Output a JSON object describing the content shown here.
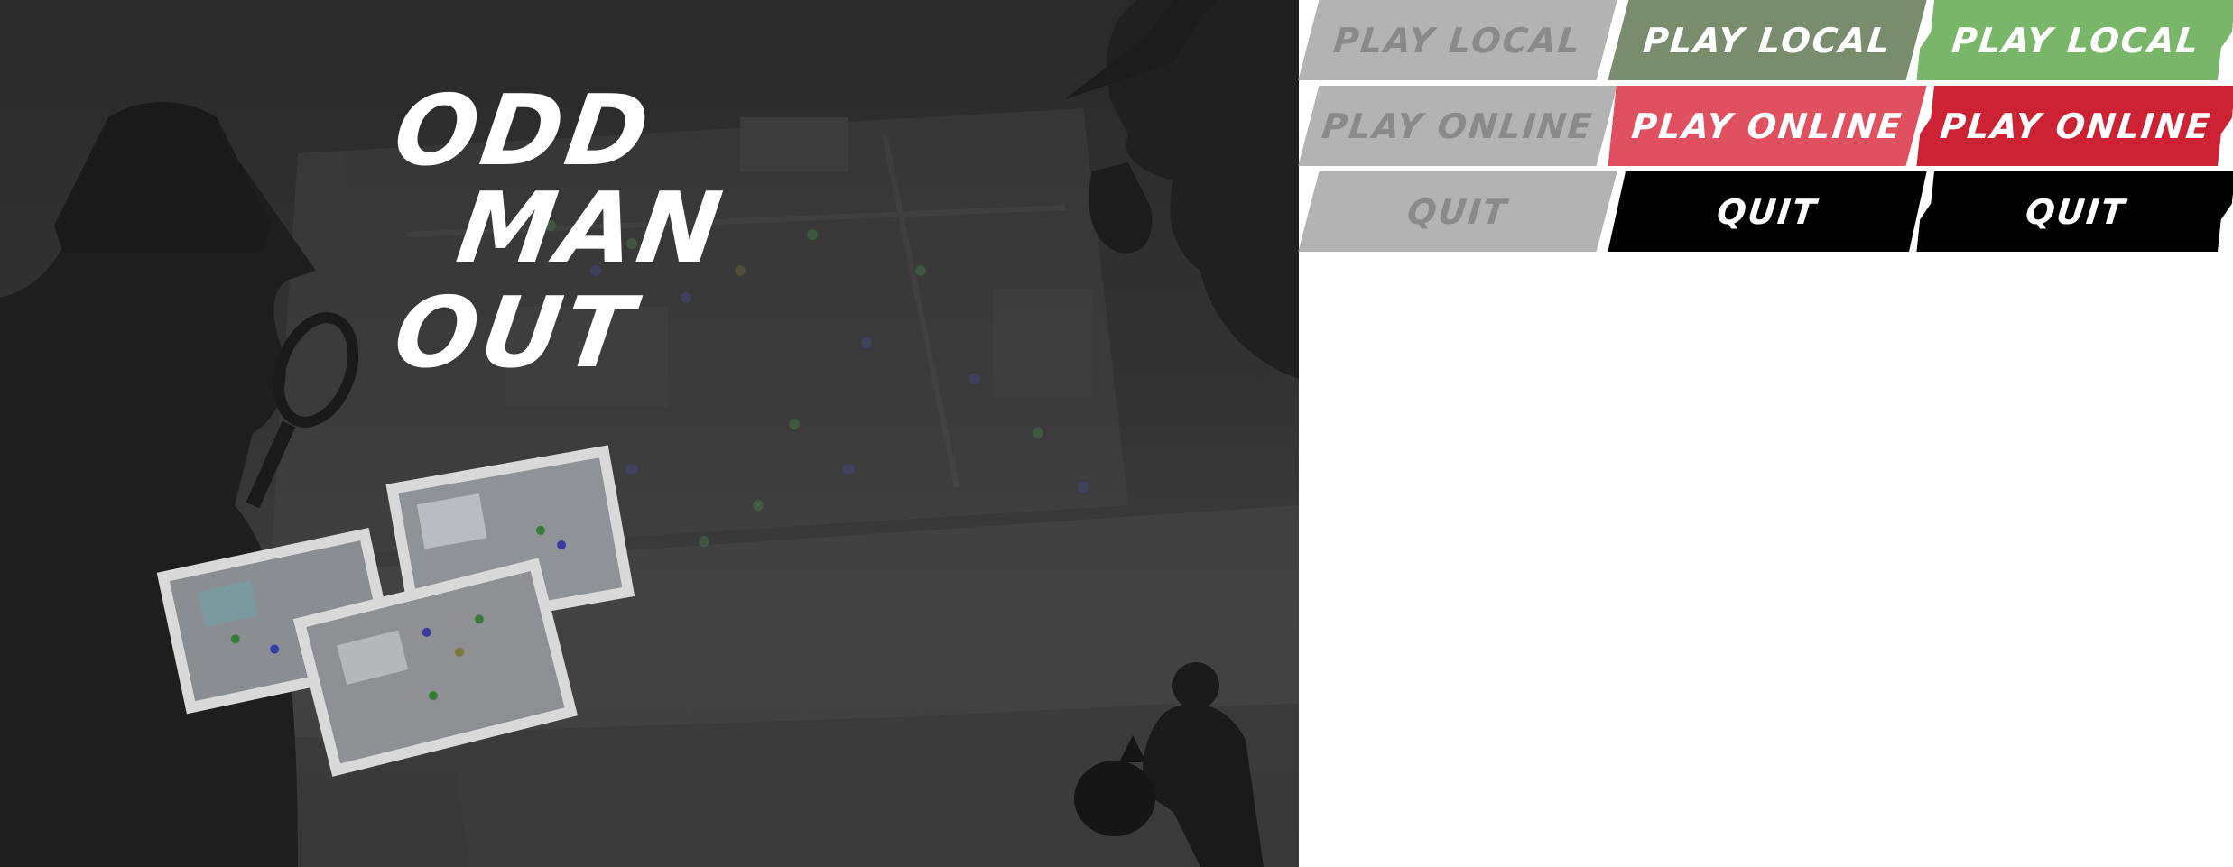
{
  "game_title": {
    "line1": "ODD",
    "line2": "MAN",
    "line3": "OUT"
  },
  "button_sheet": {
    "column_disabled": {
      "play_local": "PLAY LOCAL",
      "play_online": "PLAY ONLINE",
      "quit": "QUIT"
    },
    "column_normal": {
      "play_local": "PLAY LOCAL",
      "play_online": "PLAY ONLINE",
      "quit": "QUIT"
    },
    "column_hover": {
      "play_local": "PLAY LOCAL",
      "play_online": "PLAY ONLINE",
      "quit": "QUIT"
    }
  },
  "colors": {
    "disabled_bg": "#b3b3b3",
    "disabled_text": "#8a8a8a",
    "local_normal": "#7a8c6e",
    "local_hover": "#7ab66a",
    "online_normal": "#e05060",
    "online_hover": "#cc2233",
    "quit_bg": "#000000",
    "title_text": "#ffffff"
  },
  "icons": [
    "detective-silhouette-icon",
    "magnifying-glass-icon",
    "pipe-detective-icon",
    "thief-with-sack-icon",
    "evidence-photo-icon"
  ]
}
